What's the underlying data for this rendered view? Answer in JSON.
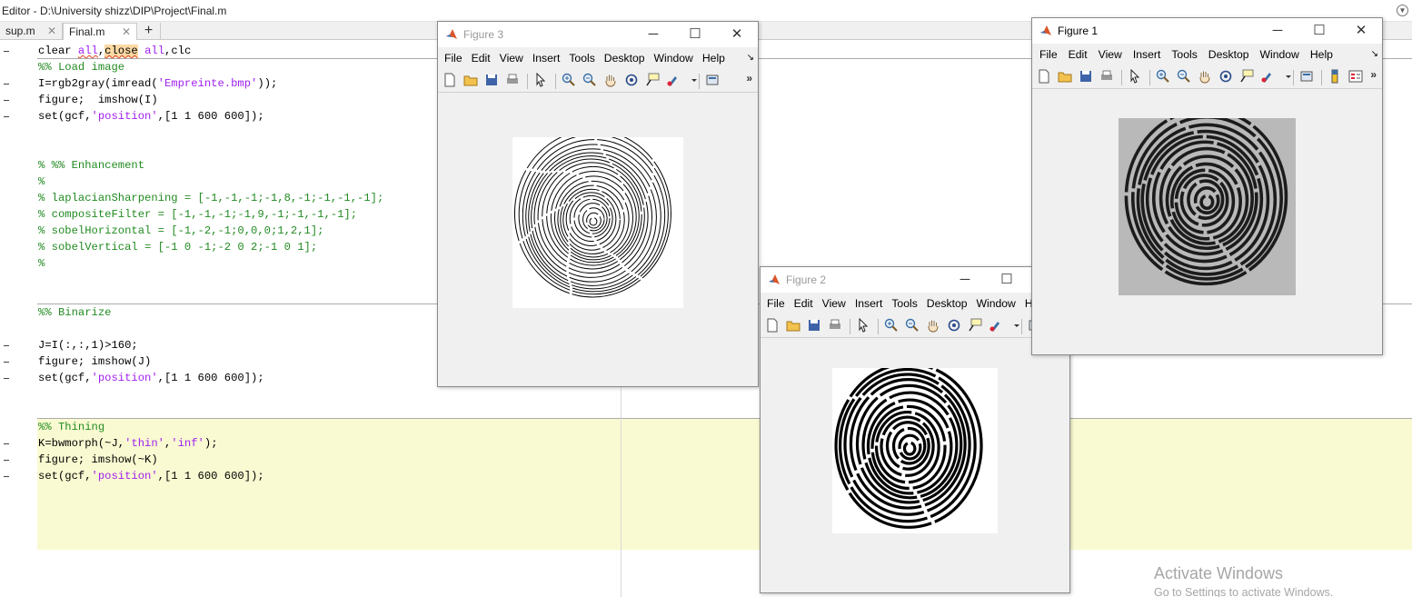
{
  "editor": {
    "title": "Editor - D:\\University shizz\\DIP\\Project\\Final.m",
    "tabs": [
      {
        "label": "sup.m"
      },
      {
        "label": "Final.m"
      }
    ],
    "add_tab": "+",
    "code": {
      "l1a": "clear ",
      "l1b": "all",
      "l1c": ",",
      "l1d": "close",
      "l1e": " ",
      "l1f": "all",
      "l1g": ",clc",
      "l2": "%% Load image",
      "l3a": "I=rgb2gray(imread(",
      "l3b": "'Empreinte.bmp'",
      "l3c": "));",
      "l4": "figure;  imshow(I)",
      "l5a": "set(gcf,",
      "l5b": "'position'",
      "l5c": ",[1 1 600 600]);",
      "l8": "% %% Enhancement",
      "l9": "%",
      "l10": "% laplacianSharpening = [-1,-1,-1;-1,8,-1;-1,-1,-1];",
      "l11": "% compositeFilter = [-1,-1,-1;-1,9,-1;-1,-1,-1];",
      "l12": "% sobelHorizontal = [-1,-2,-1;0,0,0;1,2,1];",
      "l13": "% sobelVertical = [-1 0 -1;-2 0 2;-1 0 1];",
      "l14": "%",
      "l17": "%% Binarize",
      "l19": "J=I(:,:,1)>160;",
      "l20": "figure; imshow(J)",
      "l21a": "set(gcf,",
      "l21b": "'position'",
      "l21c": ",[1 1 600 600]);",
      "l24": "%% Thining",
      "l25a": "K=bwmorph(~J,",
      "l25b": "'thin'",
      "l25c": ",",
      "l25d": "'inf'",
      "l25e": ");",
      "l26": "figure; imshow(~K)",
      "l27a": "set(gcf,",
      "l27b": "'position'",
      "l27c": ",[1 1 600 600]);"
    }
  },
  "figures": {
    "fig3": {
      "title": "Figure 3"
    },
    "fig2": {
      "title": "Figure 2"
    },
    "fig1": {
      "title": "Figure 1"
    }
  },
  "figure_menu": {
    "file": "File",
    "edit": "Edit",
    "view": "View",
    "insert": "Insert",
    "tools": "Tools",
    "desktop": "Desktop",
    "window": "Window",
    "help": "Help",
    "help_cut": "H"
  },
  "watermark": {
    "line1": "Activate Windows",
    "line2": "Go to Settings to activate Windows."
  },
  "colors": {
    "comment": "#228b22",
    "string": "#a020f0",
    "cell_highlight": "#fafad2",
    "matlab_orange": "#d9552a"
  },
  "icons": [
    "new-figure-icon",
    "open-icon",
    "save-icon",
    "print-icon",
    "pointer-icon",
    "zoom-in-icon",
    "zoom-out-icon",
    "pan-icon",
    "rotate-icon",
    "data-cursor-icon",
    "brush-icon",
    "link-icon",
    "colorbar-icon",
    "legend-icon"
  ]
}
